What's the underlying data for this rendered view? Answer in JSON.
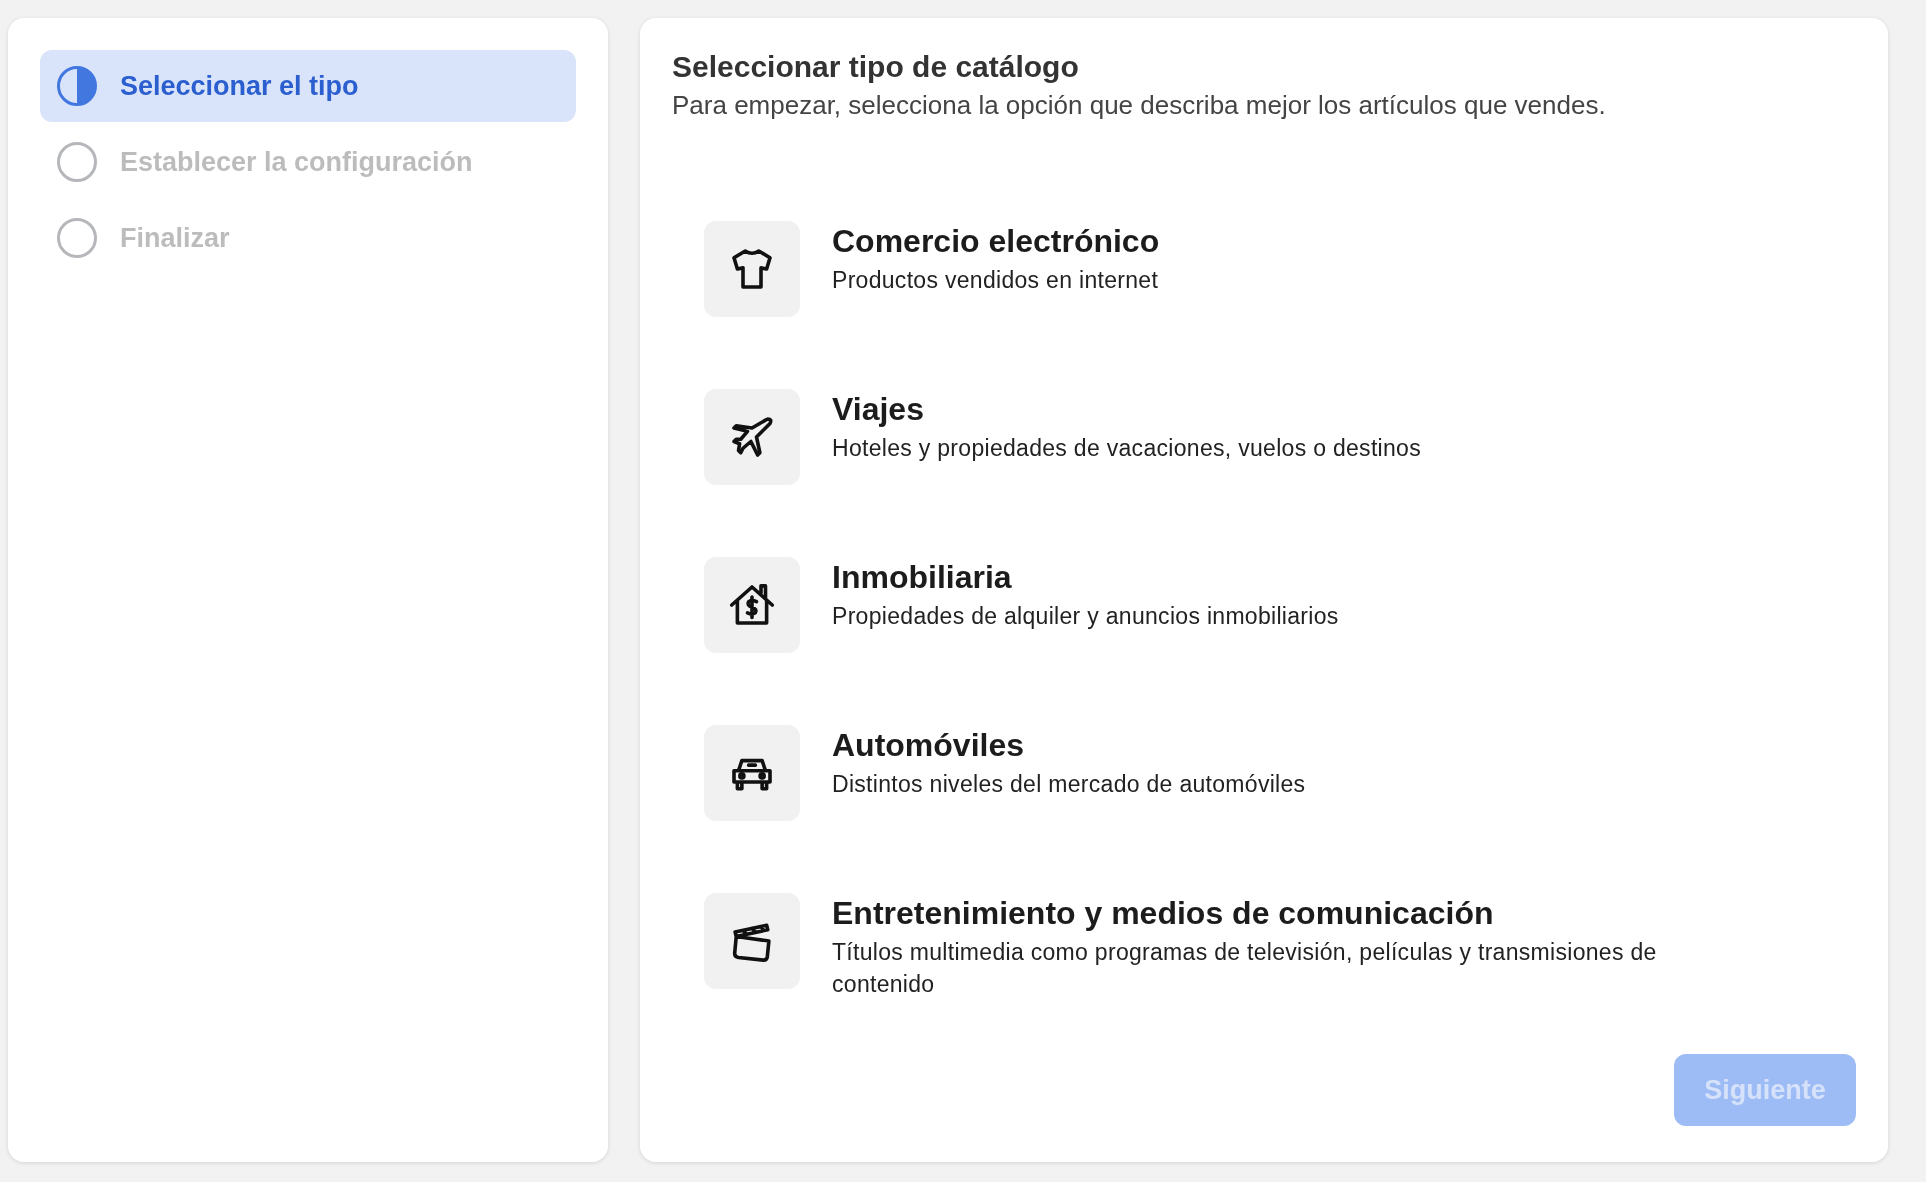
{
  "steps": [
    {
      "label": "Seleccionar el tipo",
      "selected": true
    },
    {
      "label": "Establecer la configuración",
      "selected": false
    },
    {
      "label": "Finalizar",
      "selected": false
    }
  ],
  "header": {
    "title": "Seleccionar tipo de catálogo",
    "subtitle": "Para empezar, selecciona la opción que describa mejor los artículos que vendes."
  },
  "options": [
    {
      "kind": "shirt",
      "title": "Comercio electrónico",
      "description": "Productos vendidos en internet"
    },
    {
      "kind": "plane",
      "title": "Viajes",
      "description": "Hoteles y propiedades de vacaciones, vuelos o destinos"
    },
    {
      "kind": "house",
      "title": "Inmobiliaria",
      "description": "Propiedades de alquiler y anuncios inmobiliarios"
    },
    {
      "kind": "car",
      "title": "Automóviles",
      "description": "Distintos niveles del mercado de automóviles"
    },
    {
      "kind": "clapper",
      "title": "Entretenimiento y medios de comunicación",
      "description": "Títulos multimedia como programas de televisión, películas y transmisiones de contenido"
    }
  ],
  "next_button": {
    "label": "Siguiente",
    "disabled": true
  }
}
